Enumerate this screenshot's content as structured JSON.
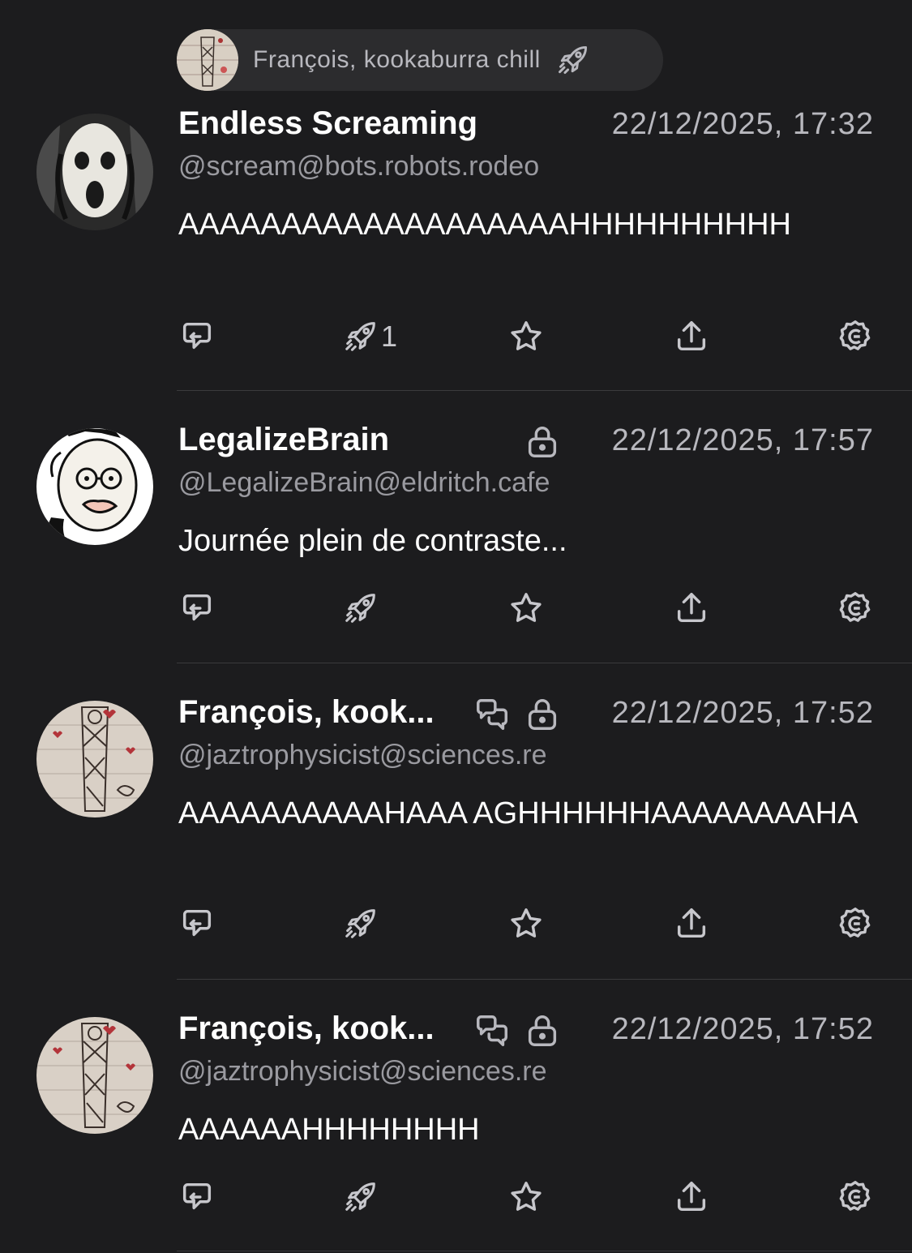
{
  "boost_header": {
    "label": "François, kookaburra chill",
    "icon": "boost-rocket-icon"
  },
  "posts": [
    {
      "display_name": "Endless Screaming",
      "handle": "@scream@bots.robots.rodeo",
      "timestamp": "22/12/2025, 17:32",
      "content": "AAAAAAAAAAAAAAAAAAAHHHHHHHHHH",
      "visibility_icon": "",
      "thread_icon": "",
      "actions": {
        "reply": "",
        "boost": "1",
        "favourite": "",
        "share": "",
        "more": ""
      }
    },
    {
      "display_name": "LegalizeBrain",
      "handle": "@LegalizeBrain@eldritch.cafe",
      "timestamp": "22/12/2025, 17:57",
      "content": "Journée plein de contraste...",
      "visibility_icon": "lock-icon",
      "thread_icon": "",
      "actions": {
        "reply": "",
        "boost": "",
        "favourite": "",
        "share": "",
        "more": ""
      }
    },
    {
      "display_name": "François, kook...",
      "handle": "@jaztrophysicist@sciences.re",
      "timestamp": "22/12/2025, 17:52",
      "content": "AAAAAAAAAAHAAA AGHHHHHHAAAAAAAAHA",
      "visibility_icon": "lock-icon",
      "thread_icon": "conversation-icon",
      "actions": {
        "reply": "",
        "boost": "",
        "favourite": "",
        "share": "",
        "more": ""
      }
    },
    {
      "display_name": "François, kook...",
      "handle": "@jaztrophysicist@sciences.re",
      "timestamp": "22/12/2025, 17:52",
      "content": "AAAAAAHHHHHHHH",
      "visibility_icon": "lock-icon",
      "thread_icon": "conversation-icon",
      "actions": {
        "reply": "",
        "boost": "",
        "favourite": "",
        "share": "",
        "more": ""
      }
    }
  ],
  "colors": {
    "background": "#1c1c1e",
    "pill_background": "#2c2c2e",
    "primary_text": "#ffffff",
    "secondary_text": "#9a9aa0",
    "icon": "#c7c7cc",
    "divider": "#3a3a3c"
  }
}
